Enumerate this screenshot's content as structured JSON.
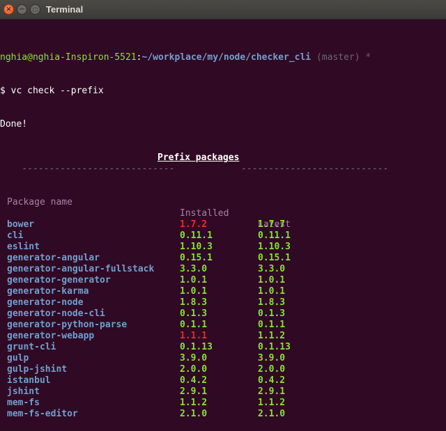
{
  "window": {
    "title": "Terminal",
    "close_glyph": "×",
    "min_glyph": "−",
    "max_glyph": "□"
  },
  "prompt": {
    "user_host": "nghia@nghia-Inspiron-5521",
    "sep": ":",
    "path": "~/workplace/my/node/checker_cli",
    "branch": " (master) *"
  },
  "command": "$ vc check --prefix",
  "done": "Done!",
  "section": {
    "dashes_left": "----------------------------",
    "title": "Prefix packages",
    "dashes_right": "---------------------------"
  },
  "table": {
    "headers": [
      "Package name",
      "Installed",
      "Latest"
    ],
    "rows": [
      {
        "name": "bower",
        "installed": "1.7.2",
        "latest": "1.7.7",
        "outdated": true
      },
      {
        "name": "cli",
        "installed": "0.11.1",
        "latest": "0.11.1",
        "outdated": false
      },
      {
        "name": "eslint",
        "installed": "1.10.3",
        "latest": "1.10.3",
        "outdated": false
      },
      {
        "name": "generator-angular",
        "installed": "0.15.1",
        "latest": "0.15.1",
        "outdated": false
      },
      {
        "name": "generator-angular-fullstack",
        "installed": "3.3.0",
        "latest": "3.3.0",
        "outdated": false
      },
      {
        "name": "generator-generator",
        "installed": "1.0.1",
        "latest": "1.0.1",
        "outdated": false
      },
      {
        "name": "generator-karma",
        "installed": "1.0.1",
        "latest": "1.0.1",
        "outdated": false
      },
      {
        "name": "generator-node",
        "installed": "1.8.3",
        "latest": "1.8.3",
        "outdated": false
      },
      {
        "name": "generator-node-cli",
        "installed": "0.1.3",
        "latest": "0.1.3",
        "outdated": false
      },
      {
        "name": "generator-python-parse",
        "installed": "0.1.1",
        "latest": "0.1.1",
        "outdated": false
      },
      {
        "name": "generator-webapp",
        "installed": "1.1.1",
        "latest": "1.1.2",
        "outdated": true
      },
      {
        "name": "grunt-cli",
        "installed": "0.1.13",
        "latest": "0.1.13",
        "outdated": false
      },
      {
        "name": "gulp",
        "installed": "3.9.0",
        "latest": "3.9.0",
        "outdated": false
      },
      {
        "name": "gulp-jshint",
        "installed": "2.0.0",
        "latest": "2.0.0",
        "outdated": false
      },
      {
        "name": "istanbul",
        "installed": "0.4.2",
        "latest": "0.4.2",
        "outdated": false
      },
      {
        "name": "jshint",
        "installed": "2.9.1",
        "latest": "2.9.1",
        "outdated": false
      },
      {
        "name": "mem-fs",
        "installed": "1.1.2",
        "latest": "1.1.2",
        "outdated": false
      },
      {
        "name": "mem-fs-editor",
        "installed": "2.1.0",
        "latest": "2.1.0",
        "outdated": false
      }
    ]
  },
  "colors": {
    "background": "#300a24",
    "outdated": "#ef2929",
    "current": "#8ae234",
    "package": "#729fcf",
    "header": "#ad7fa8"
  }
}
